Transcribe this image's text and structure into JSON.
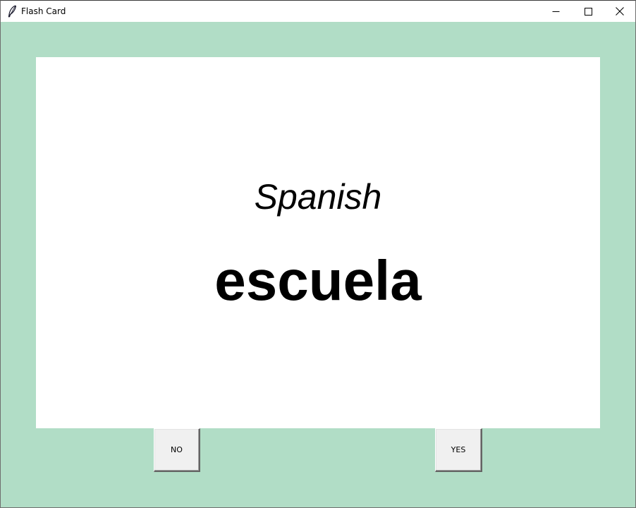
{
  "window": {
    "title": "Flash Card",
    "app_icon": "feather-icon",
    "controls": {
      "minimize_icon": "minimize-icon",
      "maximize_icon": "maximize-icon",
      "close_icon": "close-icon"
    }
  },
  "colors": {
    "background": "#b1ddc6",
    "card": "#ffffff",
    "text": "#000000",
    "button": "#f0f0f0"
  },
  "card": {
    "language": "Spanish",
    "word": "escuela"
  },
  "buttons": {
    "no_label": "NO",
    "yes_label": "YES"
  }
}
